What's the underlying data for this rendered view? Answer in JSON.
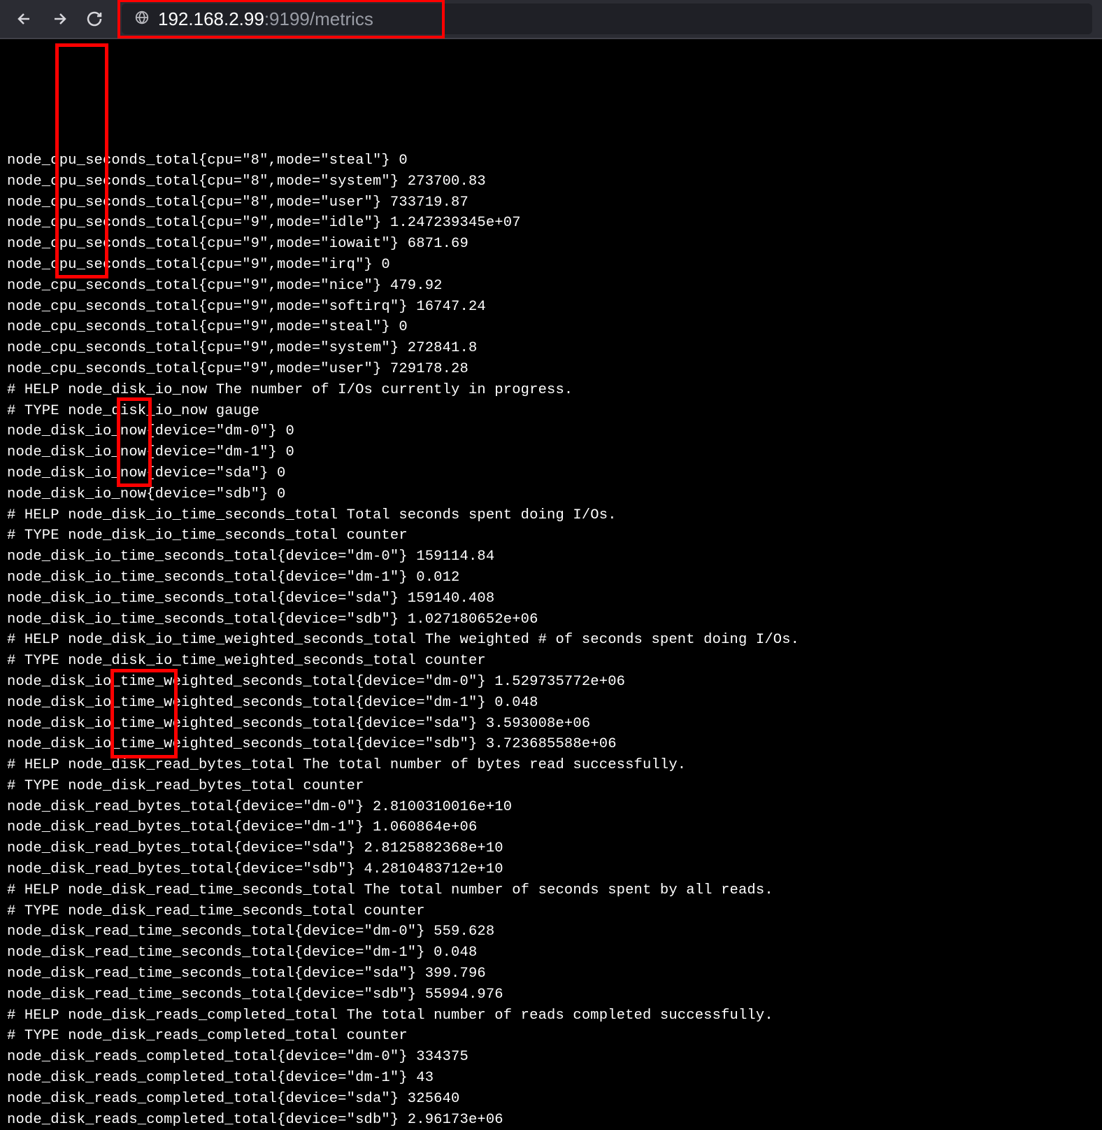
{
  "address": {
    "host": "192.168.2.99",
    "rest": ":9199/metrics"
  },
  "highlights": {
    "cpu": "cpu",
    "io": "io",
    "read": "read"
  },
  "metrics_lines": [
    "node_cpu_seconds_total{cpu=\"8\",mode=\"steal\"} 0",
    "node_cpu_seconds_total{cpu=\"8\",mode=\"system\"} 273700.83",
    "node_cpu_seconds_total{cpu=\"8\",mode=\"user\"} 733719.87",
    "node_cpu_seconds_total{cpu=\"9\",mode=\"idle\"} 1.247239345e+07",
    "node_cpu_seconds_total{cpu=\"9\",mode=\"iowait\"} 6871.69",
    "node_cpu_seconds_total{cpu=\"9\",mode=\"irq\"} 0",
    "node_cpu_seconds_total{cpu=\"9\",mode=\"nice\"} 479.92",
    "node_cpu_seconds_total{cpu=\"9\",mode=\"softirq\"} 16747.24",
    "node_cpu_seconds_total{cpu=\"9\",mode=\"steal\"} 0",
    "node_cpu_seconds_total{cpu=\"9\",mode=\"system\"} 272841.8",
    "node_cpu_seconds_total{cpu=\"9\",mode=\"user\"} 729178.28",
    "# HELP node_disk_io_now The number of I/Os currently in progress.",
    "# TYPE node_disk_io_now gauge",
    "node_disk_io_now{device=\"dm-0\"} 0",
    "node_disk_io_now{device=\"dm-1\"} 0",
    "node_disk_io_now{device=\"sda\"} 0",
    "node_disk_io_now{device=\"sdb\"} 0",
    "# HELP node_disk_io_time_seconds_total Total seconds spent doing I/Os.",
    "# TYPE node_disk_io_time_seconds_total counter",
    "node_disk_io_time_seconds_total{device=\"dm-0\"} 159114.84",
    "node_disk_io_time_seconds_total{device=\"dm-1\"} 0.012",
    "node_disk_io_time_seconds_total{device=\"sda\"} 159140.408",
    "node_disk_io_time_seconds_total{device=\"sdb\"} 1.027180652e+06",
    "# HELP node_disk_io_time_weighted_seconds_total The weighted # of seconds spent doing I/Os.",
    "# TYPE node_disk_io_time_weighted_seconds_total counter",
    "node_disk_io_time_weighted_seconds_total{device=\"dm-0\"} 1.529735772e+06",
    "node_disk_io_time_weighted_seconds_total{device=\"dm-1\"} 0.048",
    "node_disk_io_time_weighted_seconds_total{device=\"sda\"} 3.593008e+06",
    "node_disk_io_time_weighted_seconds_total{device=\"sdb\"} 3.723685588e+06",
    "# HELP node_disk_read_bytes_total The total number of bytes read successfully.",
    "# TYPE node_disk_read_bytes_total counter",
    "node_disk_read_bytes_total{device=\"dm-0\"} 2.8100310016e+10",
    "node_disk_read_bytes_total{device=\"dm-1\"} 1.060864e+06",
    "node_disk_read_bytes_total{device=\"sda\"} 2.8125882368e+10",
    "node_disk_read_bytes_total{device=\"sdb\"} 4.2810483712e+10",
    "# HELP node_disk_read_time_seconds_total The total number of seconds spent by all reads.",
    "# TYPE node_disk_read_time_seconds_total counter",
    "node_disk_read_time_seconds_total{device=\"dm-0\"} 559.628",
    "node_disk_read_time_seconds_total{device=\"dm-1\"} 0.048",
    "node_disk_read_time_seconds_total{device=\"sda\"} 399.796",
    "node_disk_read_time_seconds_total{device=\"sdb\"} 55994.976",
    "# HELP node_disk_reads_completed_total The total number of reads completed successfully.",
    "# TYPE node_disk_reads_completed_total counter",
    "node_disk_reads_completed_total{device=\"dm-0\"} 334375",
    "node_disk_reads_completed_total{device=\"dm-1\"} 43",
    "node_disk_reads_completed_total{device=\"sda\"} 325640",
    "node_disk_reads_completed_total{device=\"sdb\"} 2.96173e+06"
  ]
}
